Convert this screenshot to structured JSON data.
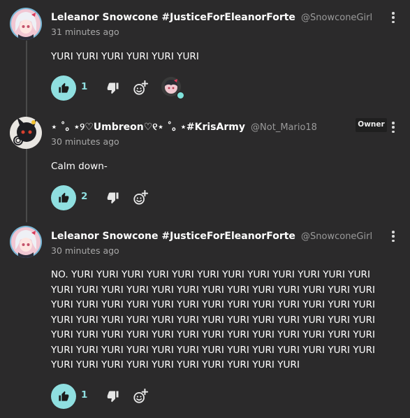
{
  "theme": {
    "background": "#2b2a2b",
    "accent": "#8fdfe0",
    "muted_text": "#9a9a9a"
  },
  "comments": [
    {
      "author": "Leleanor Snowcone #JusticeForEleanorForte",
      "handle": "@SnowconeGirl",
      "time": "31 minutes ago",
      "text": "YURI YURI YURI YURI YURI YURI",
      "likes": "1",
      "avatar_icon": "white-haired-girl-avatar",
      "has_reactor": true,
      "reactor_icon": "reactor-avatar"
    },
    {
      "author": "⋆ ˚｡ ⋆୨♡Umbreon♡୧⋆ ˚｡ ⋆#KrisArmy",
      "handle": "@Not_Mario18",
      "badge": "Owner",
      "time": "30 minutes ago",
      "text": "Calm down-",
      "likes": "2",
      "avatar_icon": "umbreon-avatar"
    },
    {
      "author": "Leleanor Snowcone #JusticeForEleanorForte",
      "handle": "@SnowconeGirl",
      "time": "30 minutes ago",
      "text_lines": [
        "NO. YURI YURI YURI YURI YURI YURI YURI YURI YURI YURI YURI YURI",
        "YURI YURI YURI YURI YURI YURI YURI YURI YURI YURI YURI YURI YURI",
        "YURI YURI YURI YURI YURI YURI YURI YURI YURI YURI YURI YURI YURI",
        "YURI YURI YURI YURI YURI YURI YURI YURI YURI YURI YURI YURI YURI",
        "YURI YURI YURI YURI YURI YURI YURI YURI YURI YURI YURI YURI YURI",
        "YURI YURI YURI YURI YURI YURI YURI YURI YURI YURI YURI YURI YURI",
        "YURI YURI YURI YURI YURI YURI YURI YURI YURI YURI"
      ],
      "likes": "1",
      "avatar_icon": "white-haired-girl-avatar"
    }
  ],
  "icons": {
    "like": "thumbs-up-icon",
    "dislike": "thumbs-down-icon",
    "react": "add-reaction-icon",
    "menu": "more-vertical-icon"
  }
}
